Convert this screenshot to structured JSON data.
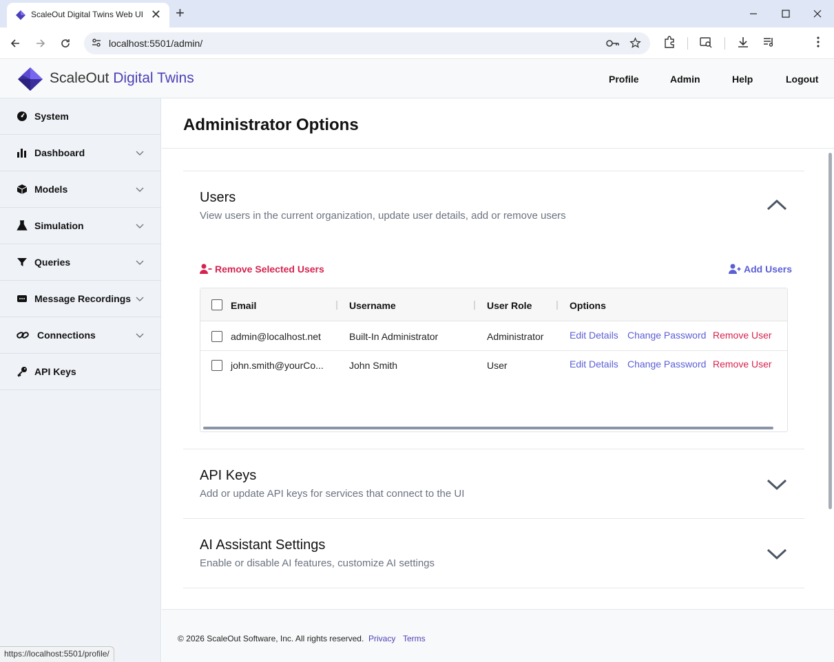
{
  "browser": {
    "tab_title": "ScaleOut Digital Twins Web UI",
    "tab_close": "✕",
    "new_tab": "+",
    "url": "localhost:5501/admin/",
    "status_url": "https://localhost:5501/profile/"
  },
  "header": {
    "brand_main": "ScaleOut",
    "brand_accent": "Digital Twins",
    "nav": [
      "Profile",
      "Admin",
      "Help",
      "Logout"
    ]
  },
  "sidebar": {
    "items": [
      {
        "label": "System",
        "icon": "gauge-icon",
        "expandable": false
      },
      {
        "label": "Dashboard",
        "icon": "bar-chart-icon",
        "expandable": true
      },
      {
        "label": "Models",
        "icon": "cube-icon",
        "expandable": true
      },
      {
        "label": "Simulation",
        "icon": "flask-icon",
        "expandable": true
      },
      {
        "label": "Queries",
        "icon": "filter-icon",
        "expandable": true
      },
      {
        "label": "Message Recordings",
        "icon": "message-icon",
        "expandable": true
      },
      {
        "label": "Connections",
        "icon": "link-icon",
        "expandable": true
      },
      {
        "label": "API Keys",
        "icon": "key-icon",
        "expandable": false
      }
    ]
  },
  "main": {
    "title": "Administrator Options",
    "sections": [
      {
        "title": "Users",
        "description": "View users in the current organization, update user details, add or remove users",
        "expanded": true
      },
      {
        "title": "API Keys",
        "description": "Add or update API keys for services that connect to the UI",
        "expanded": false
      },
      {
        "title": "AI Assistant Settings",
        "description": "Enable or disable AI features, customize AI settings",
        "expanded": false
      }
    ],
    "users": {
      "remove_selected_label": "Remove Selected Users",
      "add_users_label": "Add Users",
      "columns": [
        "Email",
        "Username",
        "User Role",
        "Options"
      ],
      "rows": [
        {
          "email": "admin@localhost.net",
          "username": "Built-In Administrator",
          "role": "Administrator",
          "checked": false
        },
        {
          "email": "john.smith@yourCo...",
          "username": "John Smith",
          "role": "User",
          "checked": false
        }
      ],
      "options": [
        "Edit Details",
        "Change Password",
        "Remove User"
      ]
    }
  },
  "footer": {
    "copyright": "© 2026 ScaleOut Software, Inc. All rights reserved.",
    "links": [
      "Privacy",
      "Terms"
    ]
  },
  "colors": {
    "accent_purple": "#5b5fd6",
    "brand_purple": "#4b3fb8",
    "danger_red": "#d6224e",
    "sidebar_bg": "#eff2f7"
  }
}
